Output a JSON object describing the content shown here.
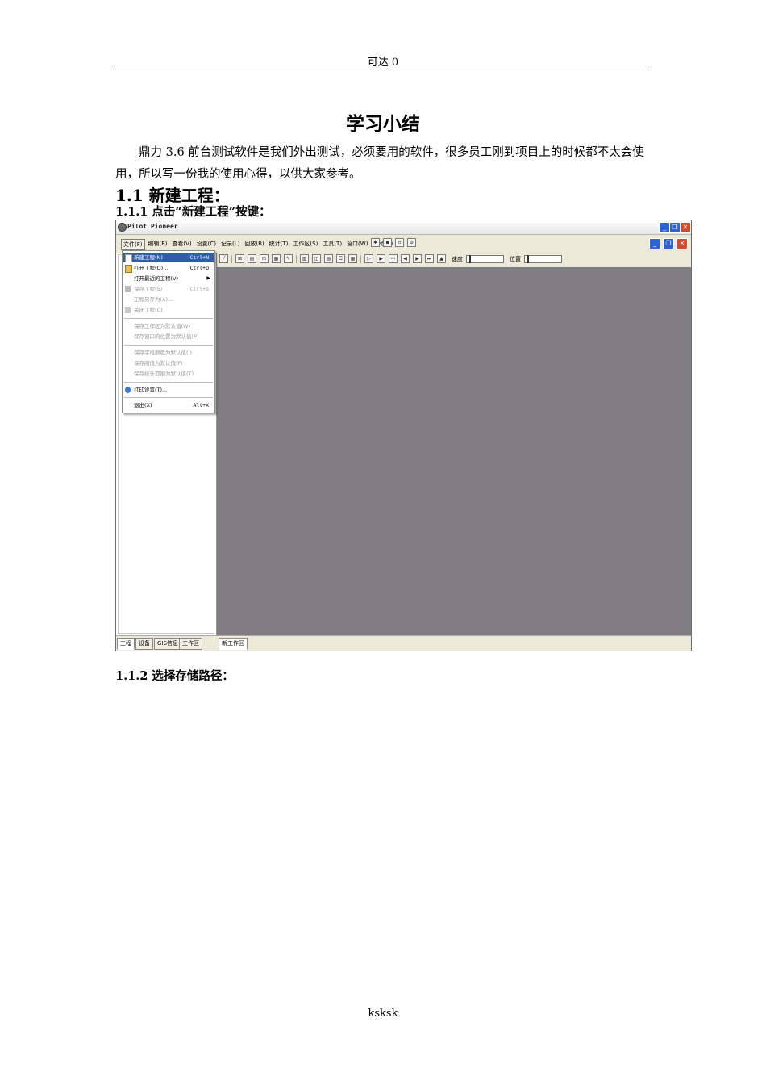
{
  "page": {
    "header": "可达 0",
    "title": "学习小结",
    "intro": "鼎力 3.6 前台测试软件是我们外出测试，必须要用的软件，很多员工刚到项目上的时候都不太会使用，所以写一份我的使用心得，以供大家参考。",
    "section_1": "1.1 新建工程：",
    "section_1_1": "1.1.1 点击“新建工程”按键：",
    "section_1_2": "1.1.2 选择存储路径：",
    "footer": "ksksk"
  },
  "app": {
    "window_title": "Pilot Pioneer",
    "menu": [
      "文件(F)",
      "编辑(E)",
      "查看(V)",
      "设置(C)",
      "记录(L)",
      "回放(B)",
      "统计(T)",
      "工作区(S)",
      "工具(T)",
      "窗口(W)",
      "帮助(H)"
    ],
    "speed_label": "速度",
    "position_label": "位置",
    "file_menu": {
      "new_project": "新建工程(N)",
      "new_project_shortcut": "Ctrl+N",
      "open_project": "打开工程(O)...",
      "open_project_shortcut": "Ctrl+O",
      "open_recent": "打开最近的工程(V)",
      "save_project": "保存工程(S)",
      "save_project_shortcut": "Ctrl+S",
      "save_as": "工程另存为(A)...",
      "close_project": "关闭工程(C)",
      "save_workspace_default": "保存工作区为默认值(W)",
      "save_window_pos_default": "保存窗口的位置为默认值(P)",
      "save_field_color_default": "保存字段颜色为默认值(I)",
      "save_threshold_default": "保存阈值为默认值(F)",
      "save_stat_range_default": "保存统计范围为默认值(T)",
      "print_setup": "打印设置(T)...",
      "exit": "退出(X)",
      "exit_shortcut": "Alt+X"
    },
    "left_tabs": [
      "工程",
      "设备",
      "GIS信息",
      "工作区"
    ],
    "workspace_tab": "新工作区"
  }
}
